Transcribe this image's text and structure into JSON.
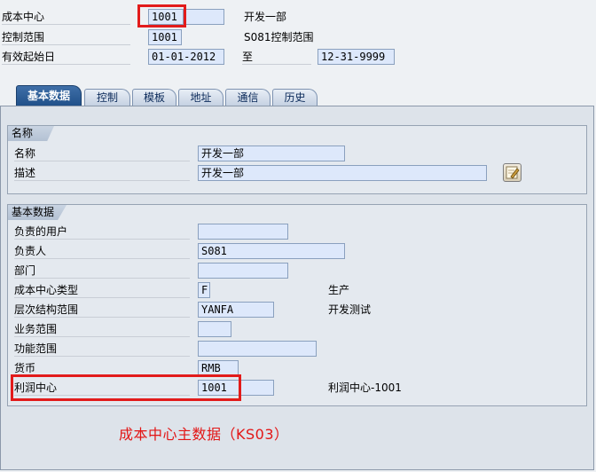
{
  "header": {
    "cost_center_label": "成本中心",
    "cost_center_value": "1001",
    "cost_center_name": "开发一部",
    "control_area_label": "控制范围",
    "control_area_value": "1001",
    "control_area_desc": "S081控制范围",
    "valid_from_label": "有效起始日",
    "valid_from_value": "01-01-2012",
    "to_label": "至",
    "valid_to_value": "12-31-9999"
  },
  "tabs": [
    {
      "label": "基本数据",
      "active": true
    },
    {
      "label": "控制",
      "active": false
    },
    {
      "label": "模板",
      "active": false
    },
    {
      "label": "地址",
      "active": false
    },
    {
      "label": "通信",
      "active": false
    },
    {
      "label": "历史",
      "active": false
    }
  ],
  "names_group": {
    "title": "名称",
    "name_label": "名称",
    "name_value": "开发一部",
    "desc_label": "描述",
    "desc_value": "开发一部"
  },
  "basic_group": {
    "title": "基本数据",
    "rows": [
      {
        "label": "负责的用户",
        "value": "",
        "desc": ""
      },
      {
        "label": "负责人",
        "value": "S081",
        "desc": ""
      },
      {
        "label": "部门",
        "value": "",
        "desc": ""
      },
      {
        "label": "成本中心类型",
        "value": "F",
        "desc": "生产"
      },
      {
        "label": "层次结构范围",
        "value": "YANFA",
        "desc": "开发测试"
      },
      {
        "label": "业务范围",
        "value": "",
        "desc": ""
      },
      {
        "label": "功能范围",
        "value": "",
        "desc": ""
      },
      {
        "label": "货币",
        "value": "RMB",
        "desc": ""
      },
      {
        "label": "利润中心",
        "value": "1001",
        "desc": "利润中心-1001"
      }
    ]
  },
  "caption": "成本中心主数据（KS03）",
  "colors": {
    "highlight_red": "#e21b1b",
    "field_bg": "#dde8fb",
    "active_tab": "#2a5b95"
  },
  "icons": {
    "edit_long_text": "pencil-note-icon"
  }
}
